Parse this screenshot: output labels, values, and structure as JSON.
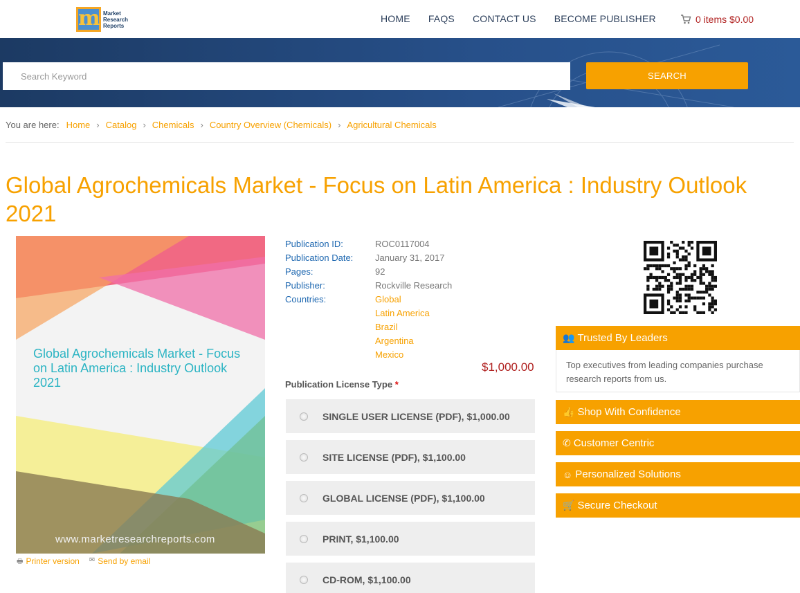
{
  "header": {
    "logo_text": "Market Research Reports",
    "nav": [
      "HOME",
      "FAQS",
      "CONTACT US",
      "BECOME PUBLISHER"
    ],
    "cart": "0 items $0.00"
  },
  "search": {
    "placeholder": "Search Keyword",
    "button": "SEARCH"
  },
  "breadcrumb": {
    "label": "You are here:",
    "items": [
      "Home",
      "Catalog",
      "Chemicals",
      "Country Overview (Chemicals)",
      "Agricultural Chemicals"
    ]
  },
  "product": {
    "title": "Global Agrochemicals Market - Focus on Latin America : Industry Outlook 2021",
    "cover_title": "Global Agrochemicals Market - Focus on Latin America : Industry Outlook 2021",
    "cover_url": "www.marketresearchreports.com",
    "printer_link": "Printer version",
    "email_link": "Send by email",
    "meta": {
      "id_label": "Publication ID:",
      "id": "ROC0117004",
      "date_label": "Publication Date:",
      "date": "January 31, 2017",
      "pages_label": "Pages:",
      "pages": "92",
      "publisher_label": "Publisher:",
      "publisher": "Rockville Research",
      "countries_label": "Countries:",
      "countries": [
        "Global",
        "Latin America",
        "Brazil",
        "Argentina",
        "Mexico"
      ]
    },
    "price": "$1,000.00",
    "license_type_label": "Publication License Type",
    "required_mark": "*",
    "licenses": [
      "SINGLE USER LICENSE (PDF), $1,000.00",
      "SITE LICENSE (PDF), $1,100.00",
      "GLOBAL LICENSE (PDF), $1,100.00",
      "PRINT, $1,100.00",
      "CD-ROM, $1,100.00"
    ]
  },
  "sidebar": {
    "trusted_title": "Trusted By Leaders",
    "trusted_body": "Top executives from leading companies purchase research reports from us.",
    "items": [
      "Shop With Confidence",
      "Customer Centric",
      "Personalized Solutions",
      "Secure Checkout"
    ]
  },
  "colors": {
    "accent": "#f7a100",
    "navy": "#1c3a63",
    "price_red": "#b0201f",
    "link_blue": "#1d67b0"
  }
}
